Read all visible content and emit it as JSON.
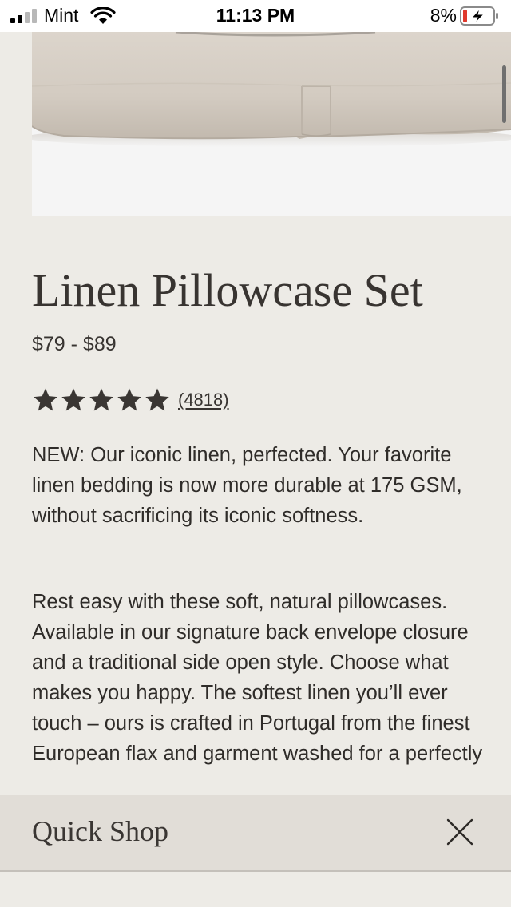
{
  "status_bar": {
    "carrier": "Mint",
    "time": "11:13 PM",
    "battery_percent": "8%",
    "signal_icon": "cellular-signal-icon",
    "wifi_icon": "wifi-icon",
    "battery_icon": "battery-charging-icon",
    "battery_low_color": "#e0392d"
  },
  "product": {
    "image": "linen-pillowcase-photo",
    "title": "Linen Pillowcase Set",
    "price": "$79 - $89",
    "rating": {
      "stars": 5,
      "star_icon": "star-icon",
      "review_count": "(4818)"
    },
    "description": [
      "NEW: Our iconic linen, perfected. Your favorite linen bedding is now more durable at 175 GSM, without sacrificing its iconic softness.",
      "Rest easy with these soft, natural pillowcases. Available in our signature back envelope closure and a traditional side open style. Choose what makes you happy. The softest linen you’ll ever touch – ours is crafted in Portugal from the finest European flax and garment washed for a perfectly"
    ]
  },
  "quick_shop": {
    "label": "Quick Shop",
    "close_icon": "close-icon"
  },
  "colors": {
    "page_background": "#edebe6",
    "text": "#2d2a27",
    "quick_shop_background": "#e1ddd7"
  }
}
